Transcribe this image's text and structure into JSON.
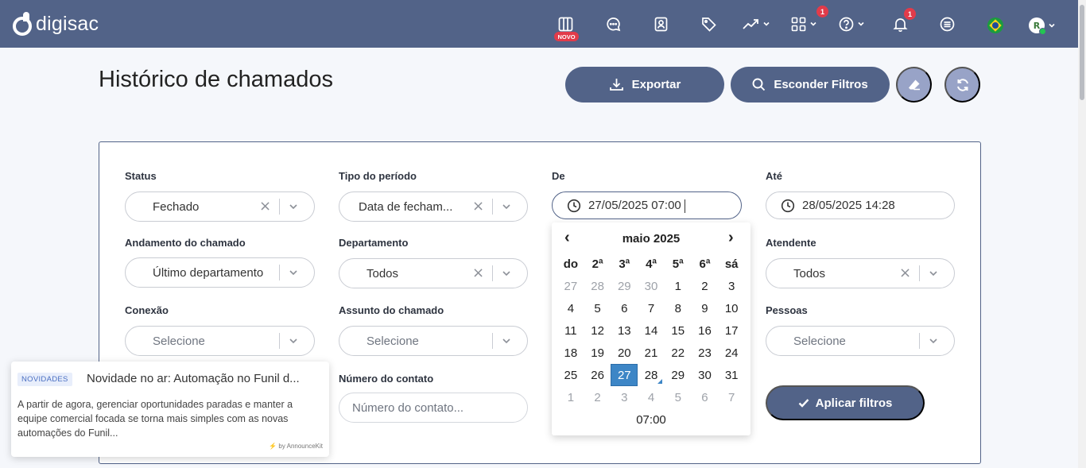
{
  "app": {
    "logo_text": "digisac"
  },
  "topbar": {
    "novo_badge": "NOVO",
    "apps_badge": "1",
    "notifications_badge": "1",
    "avatar_initial": "R"
  },
  "header": {
    "title": "Histórico de chamados",
    "export_label": "Exportar",
    "hide_filters_label": "Esconder Filtros"
  },
  "filters": {
    "status": {
      "label": "Status",
      "value": "Fechado"
    },
    "period_type": {
      "label": "Tipo do período",
      "value": "Data de fecham..."
    },
    "from": {
      "label": "De",
      "value": "27/05/2025 07:00"
    },
    "to": {
      "label": "Até",
      "value": "28/05/2025 14:28"
    },
    "progress": {
      "label": "Andamento do chamado",
      "value": "Último departamento"
    },
    "department": {
      "label": "Departamento",
      "value": "Todos"
    },
    "attendant": {
      "label": "Atendente",
      "value": "Todos"
    },
    "connection": {
      "label": "Conexão",
      "placeholder": "Selecione"
    },
    "subject": {
      "label": "Assunto do chamado",
      "placeholder": "Selecione"
    },
    "people": {
      "label": "Pessoas",
      "placeholder": "Selecione"
    },
    "contact_number": {
      "label": "Número do contato",
      "placeholder": "Número do contato..."
    },
    "apply_label": "Aplicar filtros"
  },
  "calendar": {
    "prev": "‹",
    "next": "›",
    "month_title": "maio 2025",
    "weekdays": [
      "do",
      "2ª",
      "3ª",
      "4ª",
      "5ª",
      "6ª",
      "sá"
    ],
    "weeks": [
      [
        "27",
        "28",
        "29",
        "30",
        "1",
        "2",
        "3"
      ],
      [
        "4",
        "5",
        "6",
        "7",
        "8",
        "9",
        "10"
      ],
      [
        "11",
        "12",
        "13",
        "14",
        "15",
        "16",
        "17"
      ],
      [
        "18",
        "19",
        "20",
        "21",
        "22",
        "23",
        "24"
      ],
      [
        "25",
        "26",
        "27",
        "28",
        "29",
        "30",
        "31"
      ],
      [
        "1",
        "2",
        "3",
        "4",
        "5",
        "6",
        "7"
      ]
    ],
    "selected_day": "27",
    "today_day": "28",
    "time": "07:00"
  },
  "announcement": {
    "badge": "NOVIDADES",
    "title": "Novidade no ar: Automação no Funil d...",
    "body": "A partir de agora, gerenciar oportunidades paradas e manter a equipe comercial focada se torna mais simples com as novas automações do Funil...",
    "powered_by": "by AnnounceKit"
  },
  "colors": {
    "brand": "#526388",
    "accent": "#3d86c6",
    "badge_red": "#e23b4a",
    "secondary_button": "#98a3c7"
  }
}
